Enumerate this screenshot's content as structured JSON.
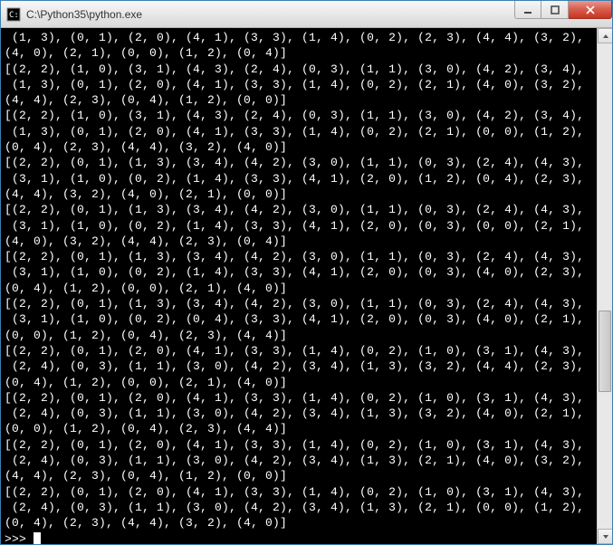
{
  "window": {
    "title": "C:\\Python35\\python.exe"
  },
  "console": {
    "lines": [
      " (1, 3), (0, 1), (2, 0), (4, 1), (3, 3), (1, 4), (0, 2), (2, 3), (4, 4), (3, 2),",
      "(4, 0), (2, 1), (0, 0), (1, 2), (0, 4)]",
      "[(2, 2), (1, 0), (3, 1), (4, 3), (2, 4), (0, 3), (1, 1), (3, 0), (4, 2), (3, 4),",
      " (1, 3), (0, 1), (2, 0), (4, 1), (3, 3), (1, 4), (0, 2), (2, 1), (4, 0), (3, 2),",
      "(4, 4), (2, 3), (0, 4), (1, 2), (0, 0)]",
      "[(2, 2), (1, 0), (3, 1), (4, 3), (2, 4), (0, 3), (1, 1), (3, 0), (4, 2), (3, 4),",
      " (1, 3), (0, 1), (2, 0), (4, 1), (3, 3), (1, 4), (0, 2), (2, 1), (0, 0), (1, 2),",
      "(0, 4), (2, 3), (4, 4), (3, 2), (4, 0)]",
      "[(2, 2), (0, 1), (1, 3), (3, 4), (4, 2), (3, 0), (1, 1), (0, 3), (2, 4), (4, 3),",
      " (3, 1), (1, 0), (0, 2), (1, 4), (3, 3), (4, 1), (2, 0), (1, 2), (0, 4), (2, 3),",
      "(4, 4), (3, 2), (4, 0), (2, 1), (0, 0)]",
      "[(2, 2), (0, 1), (1, 3), (3, 4), (4, 2), (3, 0), (1, 1), (0, 3), (2, 4), (4, 3),",
      " (3, 1), (1, 0), (0, 2), (1, 4), (3, 3), (4, 1), (2, 0), (0, 3), (0, 0), (2, 1),",
      "(4, 0), (3, 2), (4, 4), (2, 3), (0, 4)]",
      "[(2, 2), (0, 1), (1, 3), (3, 4), (4, 2), (3, 0), (1, 1), (0, 3), (2, 4), (4, 3),",
      " (3, 1), (1, 0), (0, 2), (1, 4), (3, 3), (4, 1), (2, 0), (0, 3), (4, 0), (2, 3),",
      "(0, 4), (1, 2), (0, 0), (2, 1), (4, 0)]",
      "[(2, 2), (0, 1), (1, 3), (3, 4), (4, 2), (3, 0), (1, 1), (0, 3), (2, 4), (4, 3),",
      " (3, 1), (1, 0), (0, 2), (0, 4), (3, 3), (4, 1), (2, 0), (0, 3), (4, 0), (2, 1),",
      "(0, 0), (1, 2), (0, 4), (2, 3), (4, 4)]",
      "[(2, 2), (0, 1), (2, 0), (4, 1), (3, 3), (1, 4), (0, 2), (1, 0), (3, 1), (4, 3),",
      " (2, 4), (0, 3), (1, 1), (3, 0), (4, 2), (3, 4), (1, 3), (3, 2), (4, 4), (2, 3),",
      "(0, 4), (1, 2), (0, 0), (2, 1), (4, 0)]",
      "[(2, 2), (0, 1), (2, 0), (4, 1), (3, 3), (1, 4), (0, 2), (1, 0), (3, 1), (4, 3),",
      " (2, 4), (0, 3), (1, 1), (3, 0), (4, 2), (3, 4), (1, 3), (3, 2), (4, 0), (2, 1),",
      "(0, 0), (1, 2), (0, 4), (2, 3), (4, 4)]",
      "[(2, 2), (0, 1), (2, 0), (4, 1), (3, 3), (1, 4), (0, 2), (1, 0), (3, 1), (4, 3),",
      " (2, 4), (0, 3), (1, 1), (3, 0), (4, 2), (3, 4), (1, 3), (2, 1), (4, 0), (3, 2),",
      "(4, 4), (2, 3), (0, 4), (1, 2), (0, 0)]",
      "[(2, 2), (0, 1), (2, 0), (4, 1), (3, 3), (1, 4), (0, 2), (1, 0), (3, 1), (4, 3),",
      " (2, 4), (0, 3), (1, 1), (3, 0), (4, 2), (3, 4), (1, 3), (2, 1), (0, 0), (1, 2),",
      "(0, 4), (2, 3), (4, 4), (3, 2), (4, 0)]"
    ],
    "prompt": ">>> "
  }
}
